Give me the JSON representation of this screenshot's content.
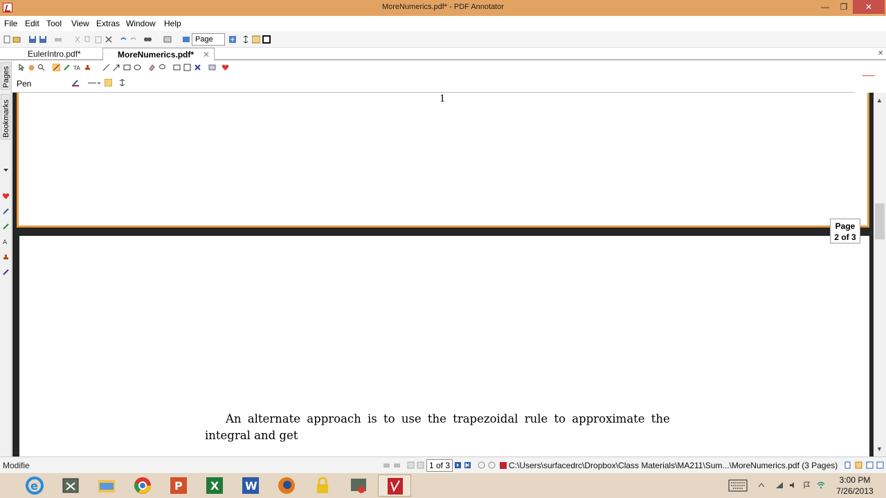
{
  "window": {
    "title": "MoreNumerics.pdf* - PDF Annotator",
    "minimize_label": "—",
    "maximize_label": "❐",
    "close_label": "✕"
  },
  "menu": [
    "File",
    "Edit",
    "Tool",
    "View",
    "Extras",
    "Window",
    "Help"
  ],
  "toolbar": {
    "page_combo_value": "Page"
  },
  "tabs": [
    {
      "label": "EulerIntro.pdf*",
      "active": false
    },
    {
      "label": "MoreNumerics.pdf*",
      "active": true
    }
  ],
  "sidebar": {
    "pages_label": "Pages",
    "bookmarks_label": "Bookmarks"
  },
  "annotation_toolbar": {
    "tool_name": "Pen"
  },
  "document": {
    "page1_number": "1",
    "page2_text_line1": "An alternate approach is to use the trapezoidal rule to approximate the",
    "page2_text_line2": "integral and get",
    "page_indicator_line1": "Page",
    "page_indicator_line2": "2 of 3"
  },
  "statusbar": {
    "status": "Modifie",
    "page_value": "1 of 3",
    "file_path": "C:\\Users\\surfacedrc\\Dropbox\\Class Materials\\MA211\\Sum...\\MoreNumerics.pdf (3 Pages)"
  },
  "taskbar": {
    "apps": [
      "internet-explorer",
      "vmware",
      "file-explorer",
      "chrome",
      "powerpoint",
      "excel",
      "word",
      "firefox",
      "keepass",
      "screen-recorder",
      "pdf-annotator"
    ],
    "time": "3:00 PM",
    "date": "7/26/2013"
  },
  "colors": {
    "titlebar": "#e2a362",
    "page_border": "#e59a43",
    "doc_background": "#262626",
    "taskbar": "#e5d7c4",
    "close_button": "#c7504a"
  }
}
